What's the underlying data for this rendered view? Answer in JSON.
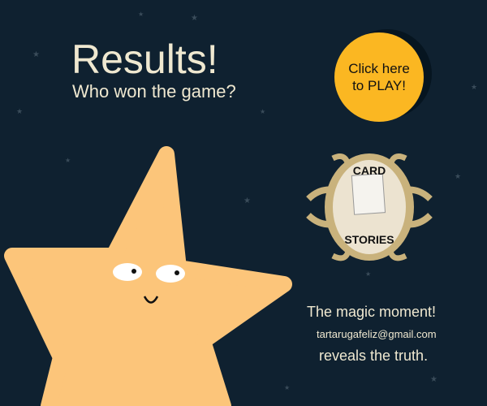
{
  "header": {
    "title": "Results!",
    "subtitle": "Who won the game?"
  },
  "play_button": {
    "label_line1": "Click here",
    "label_line2": "to PLAY!"
  },
  "logo": {
    "text_top": "CARD",
    "text_bottom": "STORIES"
  },
  "footer": {
    "line1": "The magic moment!",
    "email": "tartarugafeliz@gmail.com",
    "line3": "reveals the truth."
  },
  "colors": {
    "background": "#0f2130",
    "star": "#fcc57a",
    "button": "#fbb722",
    "text": "#efe8d0"
  }
}
